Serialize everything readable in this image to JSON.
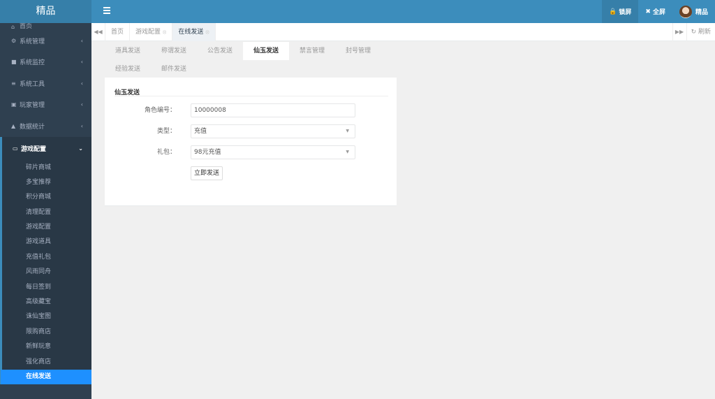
{
  "header": {
    "brand": "精品",
    "menu_icon": "hamburger-icon",
    "lock_label": "锁屏",
    "fullscreen_label": "全屏",
    "user_name": "精品",
    "accent_color": "#3c8dbc"
  },
  "sidebar": {
    "items": [
      {
        "label": "首页",
        "icon": "home-icon"
      },
      {
        "label": "系统管理",
        "icon": "gear-icon"
      },
      {
        "label": "系统监控",
        "icon": "video-icon"
      },
      {
        "label": "系统工具",
        "icon": "bars-icon"
      },
      {
        "label": "玩家管理",
        "icon": "user-card-icon"
      },
      {
        "label": "数据统计",
        "icon": "area-chart-icon"
      }
    ],
    "open_group": {
      "label": "游戏配置",
      "icon": "desktop-icon",
      "children": [
        "碎片商城",
        "多宝推荐",
        "积分商城",
        "清理配置",
        "游戏配置",
        "游戏道具",
        "充值礼包",
        "风雨同舟",
        "每日签到",
        "高级藏宝",
        "诛仙宝图",
        "限购商店",
        "新鲜玩意",
        "强化商店",
        "在线发送"
      ],
      "active_child": "在线发送"
    }
  },
  "tabbar": {
    "tabs": [
      {
        "label": "首页",
        "closable": false
      },
      {
        "label": "游戏配置",
        "closable": true
      },
      {
        "label": "在线发送",
        "closable": true,
        "active": true
      }
    ],
    "refresh_label": "刷新"
  },
  "subtabs": {
    "row1": [
      "道具发送",
      "称谓发送",
      "公告发送",
      "仙玉发送",
      "禁言管理",
      "封号管理"
    ],
    "row2": [
      "经验发送",
      "邮件发送"
    ],
    "active": "仙玉发送"
  },
  "form": {
    "title": "仙玉发送",
    "role_label": "角色编号：",
    "role_value": "10000008",
    "type_label": "类型：",
    "type_value": "充值",
    "pack_label": "礼包：",
    "pack_value": "98元充值",
    "submit_label": "立即发送"
  }
}
